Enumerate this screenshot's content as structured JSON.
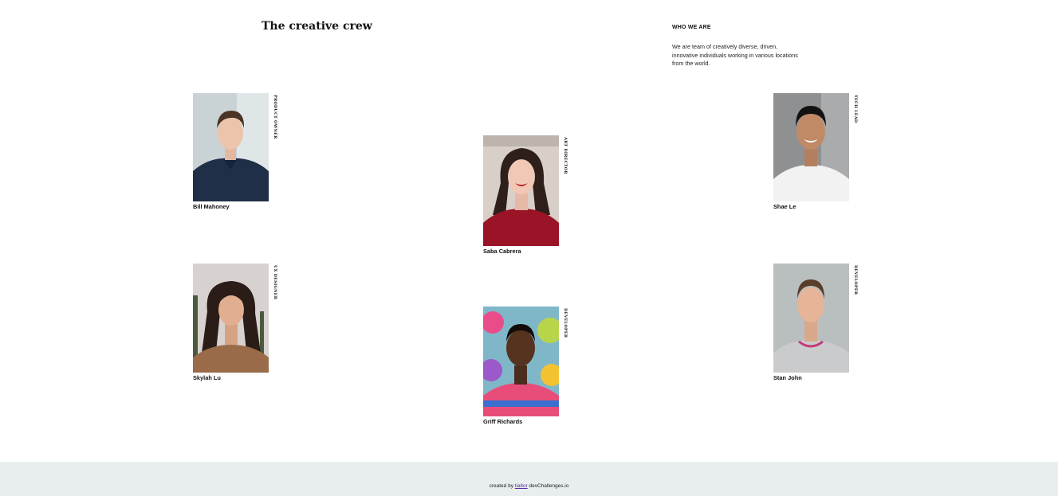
{
  "header": {
    "title": "The creative crew"
  },
  "about": {
    "heading": "WHO WE ARE",
    "text": "We are team of creatively diverse, driven, innovative individuals working in various locations from the world."
  },
  "members": [
    {
      "name": "Bill Mahoney",
      "role": "PRODUCT OWNER",
      "photo": "portrait-man-navy-polo"
    },
    {
      "name": "Saba Cabrera",
      "role": "ART DIRECTOR",
      "photo": "portrait-woman-red-sweater"
    },
    {
      "name": "Shae Le",
      "role": "TECH LEAD",
      "photo": "portrait-man-white-tee"
    },
    {
      "name": "Skylah Lu",
      "role": "UX DESIGNER",
      "photo": "portrait-woman-palm-trees"
    },
    {
      "name": "Griff Richards",
      "role": "DEVELOPER",
      "photo": "portrait-man-graffiti-wall"
    },
    {
      "name": "Stan John",
      "role": "DEVELOPER",
      "photo": "portrait-man-grey-sweater"
    }
  ],
  "footer": {
    "prefix": "created by",
    "author": "tialtor",
    "suffix": "devChallenges.io"
  },
  "colors": {
    "footer_bg": "#e8eeee",
    "link": "#5b2aa8"
  }
}
